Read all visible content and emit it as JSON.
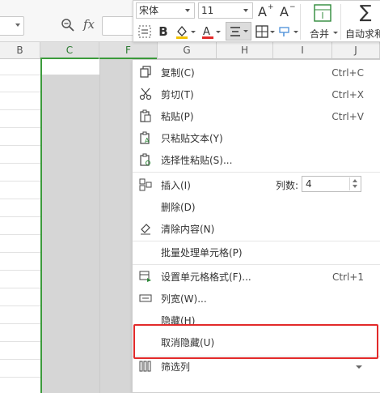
{
  "toolbar": {
    "font_name": "宋体",
    "font_size": "11",
    "merge_label": "合并",
    "autosum_label": "自动求和",
    "icons": [
      "grow-font-icon",
      "shrink-font-icon",
      "wrap-icon",
      "bold-icon",
      "fill-color-icon",
      "font-color-icon",
      "align-icon",
      "borders-icon",
      "merge-icon",
      "sum-icon"
    ],
    "accent_colors": {
      "fill": "#f2c200",
      "font": "#e22a2a"
    }
  },
  "formula_bar": {
    "fx": "fx"
  },
  "columns": [
    "B",
    "C",
    "F",
    "G",
    "H",
    "I",
    "J"
  ],
  "selected_columns": [
    "C",
    "F"
  ],
  "context_menu": {
    "items": [
      {
        "label": "复制(C)",
        "shortcut": "Ctrl+C",
        "icon": "copy-icon"
      },
      {
        "label": "剪切(T)",
        "shortcut": "Ctrl+X",
        "icon": "cut-icon"
      },
      {
        "label": "粘贴(P)",
        "shortcut": "Ctrl+V",
        "icon": "paste-icon"
      },
      {
        "label": "只粘贴文本(Y)",
        "shortcut": "",
        "icon": "paste-text-icon"
      },
      {
        "label": "选择性粘贴(S)...",
        "shortcut": "",
        "icon": "paste-special-icon"
      },
      {
        "label": "插入(I)",
        "shortcut": "",
        "icon": "insert-icon"
      },
      {
        "label": "删除(D)",
        "shortcut": "",
        "icon": ""
      },
      {
        "label": "清除内容(N)",
        "shortcut": "",
        "icon": "clear-icon"
      },
      {
        "label": "批量处理单元格(P)",
        "shortcut": "",
        "icon": ""
      },
      {
        "label": "设置单元格格式(F)...",
        "shortcut": "Ctrl+1",
        "icon": "format-cells-icon"
      },
      {
        "label": "列宽(W)...",
        "shortcut": "",
        "icon": "column-width-icon"
      },
      {
        "label": "隐藏(H)",
        "shortcut": "",
        "icon": ""
      },
      {
        "label": "取消隐藏(U)",
        "shortcut": "",
        "icon": ""
      },
      {
        "label": "筛选列",
        "shortcut": "",
        "icon": "filter-columns-icon"
      }
    ],
    "insert_count_label": "列数:",
    "insert_count_value": "4"
  },
  "highlight_color": "#e22a2a"
}
